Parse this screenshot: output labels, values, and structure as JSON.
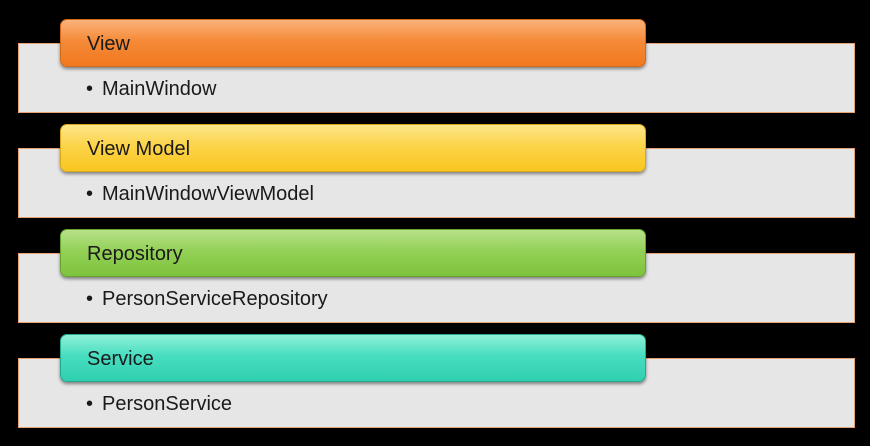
{
  "layers": [
    {
      "title": "View",
      "item": "MainWindow",
      "color": "#f58a38"
    },
    {
      "title": "View Model",
      "item": "MainWindowViewModel",
      "color": "#fcd44a"
    },
    {
      "title": "Repository",
      "item": "PersonServiceRepository",
      "color": "#93d156"
    },
    {
      "title": "Service",
      "item": "PersonService",
      "color": "#47ddc0"
    }
  ],
  "bullet": "•"
}
